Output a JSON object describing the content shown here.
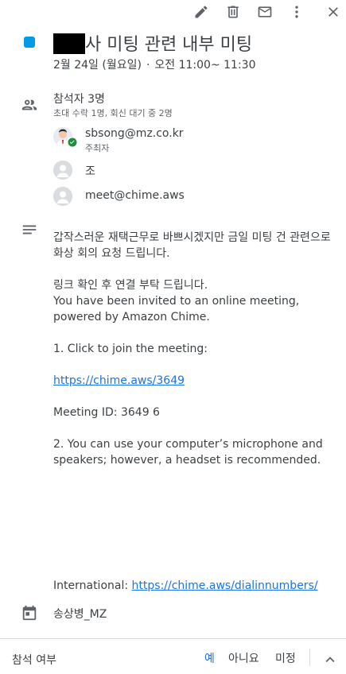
{
  "toolbar": {
    "icons": [
      "edit-icon",
      "delete-icon",
      "email-icon",
      "more-vert-icon",
      "close-icon"
    ]
  },
  "event": {
    "color": "#039be5",
    "title_suffix": "사 미팅 관련 내부 미팅",
    "date": "2월 24일 (월요일)",
    "separator": "·",
    "time": "오전 11:00~ 11:30"
  },
  "guests": {
    "heading": "참석자 3명",
    "summary": "초대 수락 1명, 회신 대기 중 2명",
    "list": [
      {
        "name": "sbsong@mz.co.kr",
        "role": "주최자",
        "accepted": true
      },
      {
        "name": "조",
        "role": "",
        "accepted": false
      },
      {
        "name": "meet@chime.aws",
        "role": "",
        "accepted": false
      }
    ]
  },
  "description": {
    "intro": "갑작스러운 재택근무로 바쁘시겠지만 금일 미팅 건 관련으로 화상 회의 요청 드립니다.",
    "line2": "링크 확인 후 연결 부탁 드립니다.",
    "line3": "You have been invited to an online meeting, powered by Amazon Chime.",
    "step1": "1. Click to join the meeting:",
    "join_link": "https://chime.aws/3649",
    "meeting_id": "Meeting ID: 3649 6",
    "step2": "2. You can use your computer’s microphone and speakers; however, a headset is recommended."
  },
  "international": {
    "label": "International:",
    "link": "https://chime.aws/dialinnumbers/"
  },
  "calendar_owner": "송상병_MZ",
  "rsvp": {
    "label": "참석 여부",
    "yes": "예",
    "no": "아니요",
    "maybe": "미정",
    "selected": "yes"
  },
  "colors": {
    "accent": "#1a73e8",
    "check": "#1e8e3e"
  }
}
